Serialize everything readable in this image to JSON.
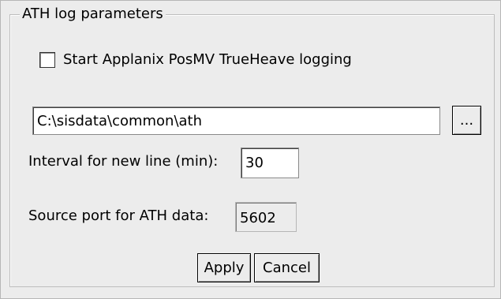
{
  "group": {
    "title": "ATH log parameters"
  },
  "logging": {
    "checkbox_label": "Start Applanix PosMV TrueHeave logging",
    "checked": false
  },
  "path": {
    "value": "C:\\sisdata\\common\\ath",
    "browse_label": "..."
  },
  "interval": {
    "label": "Interval for new line (min):",
    "value": "30"
  },
  "port": {
    "label": "Source port for ATH data:",
    "value": "5602"
  },
  "buttons": {
    "apply": "Apply",
    "cancel": "Cancel"
  }
}
